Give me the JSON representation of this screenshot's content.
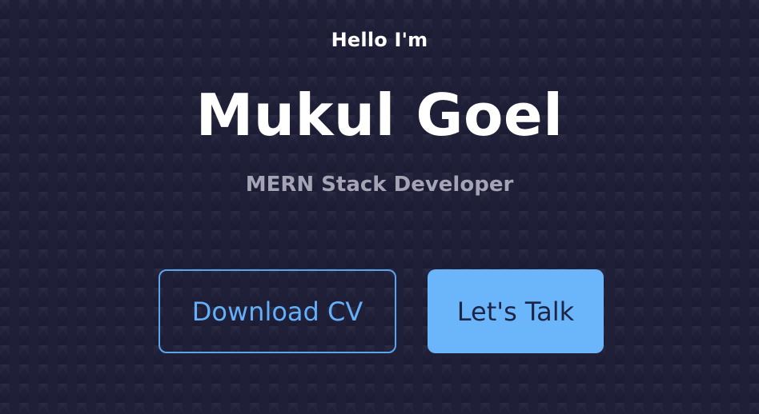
{
  "hero": {
    "greeting": "Hello I'm",
    "name": "Mukul Goel",
    "role": "MERN Stack Developer",
    "buttons": {
      "download_cv": "Download CV",
      "lets_talk": "Let's Talk"
    }
  },
  "colors": {
    "background": "#1f1f38",
    "primary_text": "#ffffff",
    "muted_text": "#a4a4b4",
    "accent": "#6bb5fb",
    "button_dark_text": "#1d2547"
  }
}
